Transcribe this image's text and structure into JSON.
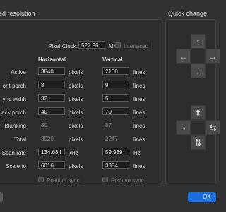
{
  "section_title": "ed resolution",
  "quick_change_title": "Quick change",
  "pixel_clock": {
    "label": "Pixel Clock:",
    "value": "527.96",
    "unit": "MHz"
  },
  "interlaced": {
    "label": "Interlaced",
    "checked": false
  },
  "headers": {
    "horizontal": "Horizontal",
    "vertical": "Vertical"
  },
  "rows": [
    {
      "label": "Active",
      "h": "3840",
      "h_unit": "pixels",
      "v": "2160",
      "v_unit": "lines",
      "readonly": false
    },
    {
      "label": "ont porch",
      "h": "8",
      "h_unit": "pixels",
      "v": "9",
      "v_unit": "lines",
      "readonly": false
    },
    {
      "label": "ync width",
      "h": "32",
      "h_unit": "pixels",
      "v": "5",
      "v_unit": "lines",
      "readonly": false
    },
    {
      "label": "ack porch",
      "h": "40",
      "h_unit": "pixels",
      "v": "70",
      "v_unit": "lines",
      "readonly": false
    },
    {
      "label": "Blanking",
      "h": "80",
      "h_unit": "pixels",
      "v": "87",
      "v_unit": "lines",
      "readonly": true
    },
    {
      "label": "Total",
      "h": "3920",
      "h_unit": "pixels",
      "v": "2247",
      "v_unit": "lines",
      "readonly": true
    },
    {
      "label": "Scan rate",
      "h": "134.684",
      "h_unit": "kHz",
      "v": "59.939",
      "v_unit": "Hz",
      "readonly": false
    },
    {
      "label": "Scale to",
      "h": "6016",
      "h_unit": "pixels",
      "v": "3384",
      "v_unit": "lines",
      "readonly": false
    }
  ],
  "h_sync": {
    "label": "Positive sync.",
    "checked": true
  },
  "v_sync": {
    "label": "Positive sync.",
    "checked": false
  },
  "ok_label": "OK",
  "icons": {
    "up": "arrow-up-icon",
    "down": "arrow-down-icon",
    "left": "arrow-left-icon",
    "right": "arrow-right-icon",
    "expand_v": "expand-vertical-icon",
    "shrink_v": "shrink-vertical-icon",
    "expand_h": "expand-horizontal-icon",
    "shrink_h": "shrink-horizontal-icon"
  },
  "colors": {
    "background": "#323232",
    "accent": "#1a6dde",
    "field": "#1e1e1e"
  }
}
